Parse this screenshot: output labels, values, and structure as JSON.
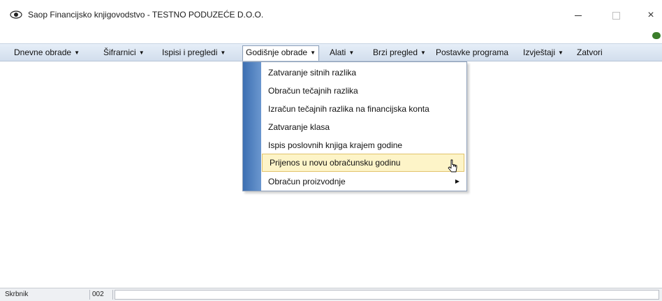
{
  "window": {
    "title": "Saop Financijsko knjigovodstvo - TESTNO PODUZEĆE D.O.O.",
    "icon": "eye-logo-icon",
    "controls": {
      "minimize": "minimize-icon",
      "maximize": "maximize-icon",
      "close": "×"
    }
  },
  "menubar": {
    "items": [
      {
        "label": "Dnevne obrade",
        "has_caret": true
      },
      {
        "label": "Šifrarnici",
        "has_caret": true
      },
      {
        "label": "Ispisi i pregledi",
        "has_caret": true
      },
      {
        "label": "Godišnje obrade",
        "has_caret": true,
        "open": true
      },
      {
        "label": "Alati",
        "has_caret": true
      },
      {
        "label": "Brzi pregled",
        "has_caret": true
      },
      {
        "label": "Postavke programa",
        "has_caret": false
      },
      {
        "label": "Izvještaji",
        "has_caret": true
      },
      {
        "label": "Zatvori",
        "has_caret": false
      }
    ],
    "caret": "▼"
  },
  "dropdown": {
    "items": [
      {
        "label": "Zatvaranje sitnih razlika"
      },
      {
        "label": "Obračun tečajnih razlika"
      },
      {
        "label": "Izračun tečajnih razlika na financijska konta"
      },
      {
        "label": "Zatvaranje klasa"
      },
      {
        "label": "Ispis poslovnih knjiga krajem godine"
      },
      {
        "label": "Prijenos u novu obračunsku godinu",
        "highlighted": true
      },
      {
        "label": "Obračun proizvodnje",
        "submenu": true
      }
    ],
    "submenu_arrow": "▶"
  },
  "statusbar": {
    "user": "Skrbnik",
    "code": "002",
    "message": ""
  },
  "colors": {
    "menubar": "#d2deed",
    "dropdown_strip": "#3c6fb2",
    "highlight": "#fdf4c8"
  }
}
